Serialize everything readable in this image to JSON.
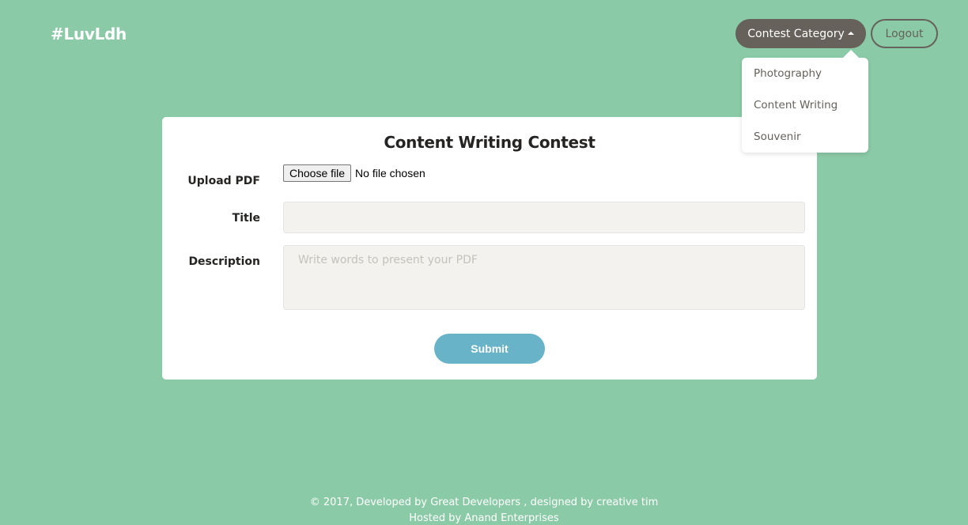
{
  "navbar": {
    "brand": "#LuvLdh",
    "category_button": "Contest Category",
    "logout_button": "Logout"
  },
  "dropdown": {
    "items": [
      "Photography",
      "Content Writing",
      "Souvenir"
    ]
  },
  "form": {
    "title": "Content Writing Contest",
    "upload_label": "Upload PDF",
    "file_button": "Choose file",
    "file_status": "No file chosen",
    "title_label": "Title",
    "title_value": "",
    "description_label": "Description",
    "description_placeholder": "Write words to present your PDF",
    "submit_button": "Submit"
  },
  "footer": {
    "line1": "© 2017, Developed by Great Developers , designed by creative tim",
    "line2": "Hosted by Anand Enterprises"
  },
  "colors": {
    "background": "#8bcaa7",
    "dark_button": "#66615b",
    "submit": "#68b3c8"
  }
}
